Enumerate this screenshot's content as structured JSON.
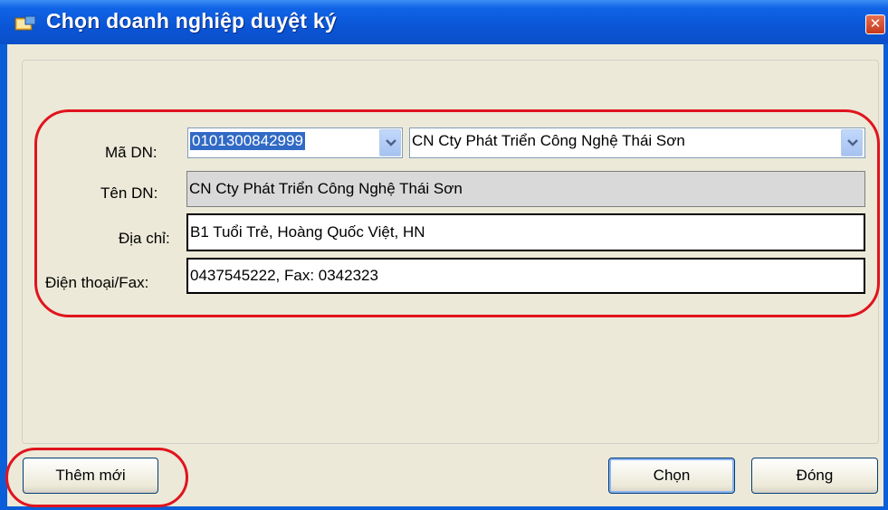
{
  "window": {
    "title": "Chọn doanh nghiệp duyệt ký",
    "close_glyph": "✕"
  },
  "form": {
    "ma_dn_label": "Mã DN:",
    "ma_dn_value": "0101300842999",
    "ten_combo_value": "CN Cty Phát Triển Công Nghệ Thái Sơn",
    "ten_dn_label": "Tên DN:",
    "ten_dn_value": "CN Cty Phát Triển Công Nghệ Thái Sơn",
    "dia_chi_label": "Địa chỉ:",
    "dia_chi_value": "B1 Tuổi Trẻ, Hoàng Quốc Việt, HN",
    "dien_thoai_label": "Điện thoại/Fax:",
    "dien_thoai_value": "0437545222, Fax: 0342323"
  },
  "buttons": {
    "them_moi": "Thêm mới",
    "chon": "Chọn",
    "dong": "Đóng"
  },
  "icons": {
    "app": "window-app-icon",
    "close": "close-icon",
    "dropdown": "chevron-down-icon"
  },
  "colors": {
    "titlebar": "#0a55d6",
    "client_bg": "#ece9d8",
    "annotation": "#e0141e",
    "selection": "#316ac5"
  }
}
